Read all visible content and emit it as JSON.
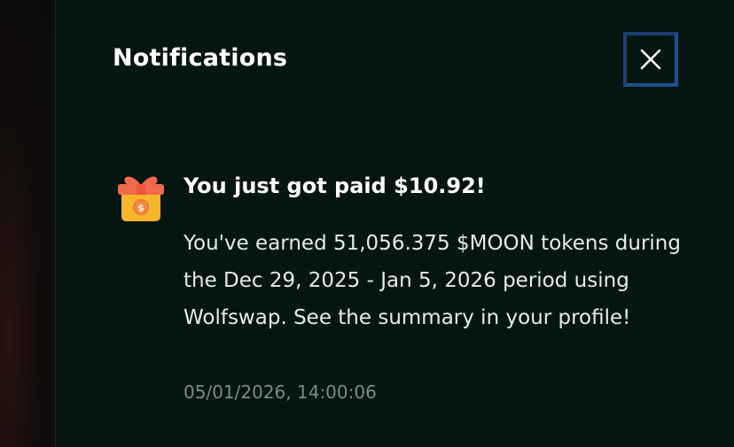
{
  "panel": {
    "title": "Notifications",
    "close_icon": "close-icon"
  },
  "notifications": [
    {
      "icon": "gift-icon",
      "title": "You just got paid $10.92!",
      "body": "You've earned 51,056.375 $MOON tokens during the Dec 29, 2025 - Jan 5, 2026 period using Wolfswap. See the summary in your profile!",
      "timestamp": "05/01/2026, 14:00:06"
    }
  ],
  "colors": {
    "panel_background": "#051512",
    "close_focus_ring": "#1e4f8c",
    "gift_box": "#f7b52c",
    "gift_ribbon": "#ef6a4c",
    "timestamp": "#7e8b89"
  }
}
